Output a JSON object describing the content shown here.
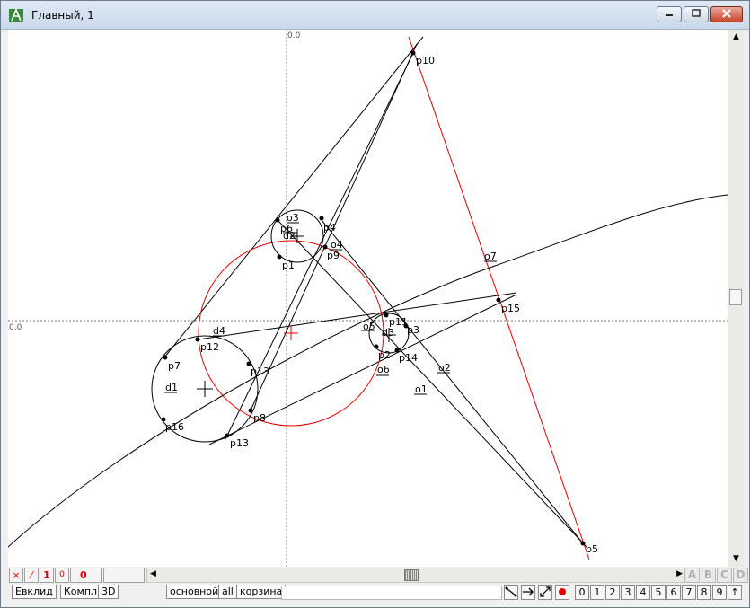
{
  "window": {
    "title": "Главный, 1",
    "minimize_icon": "minimize-icon",
    "maximize_icon": "maximize-icon",
    "close_icon": "close-icon"
  },
  "canvas": {
    "axis_label_top": "0.0",
    "axis_label_left": "0.0",
    "labels": {
      "p1": "p1",
      "p3": "p3",
      "p4": "p4",
      "p5": "p5",
      "p6": "p6",
      "p7": "p7",
      "p8": "p8",
      "p9": "p9",
      "p10": "p10",
      "p11": "p11",
      "p12": "p12",
      "p13a": "p13",
      "p13b": "p13",
      "p14": "p14",
      "p15": "p15",
      "p16": "p16",
      "p2": "p2",
      "d1": "d1",
      "d2": "d2",
      "d3": "d3",
      "d4": "d4",
      "o1": "o1",
      "o2": "o2",
      "o3": "o3",
      "o4": "o4",
      "o5": "o5",
      "o6": "o6",
      "o7": "o7"
    }
  },
  "toolbar": {
    "btn_x": "×",
    "btn_slash": "⁄",
    "btn_one": "1",
    "btn_zero_small": "0",
    "counter": "0",
    "letters": [
      "A",
      "B",
      "C",
      "D"
    ]
  },
  "tabs": {
    "left": [
      "Евклид",
      "Компл.",
      "3D"
    ],
    "right": [
      "основной",
      "all",
      "корзина"
    ]
  },
  "numbers": [
    "0",
    "1",
    "2",
    "3",
    "4",
    "5",
    "6",
    "7",
    "8",
    "9",
    "↑"
  ],
  "colors": {
    "accent_red": "#e00000",
    "line": "#000000"
  }
}
